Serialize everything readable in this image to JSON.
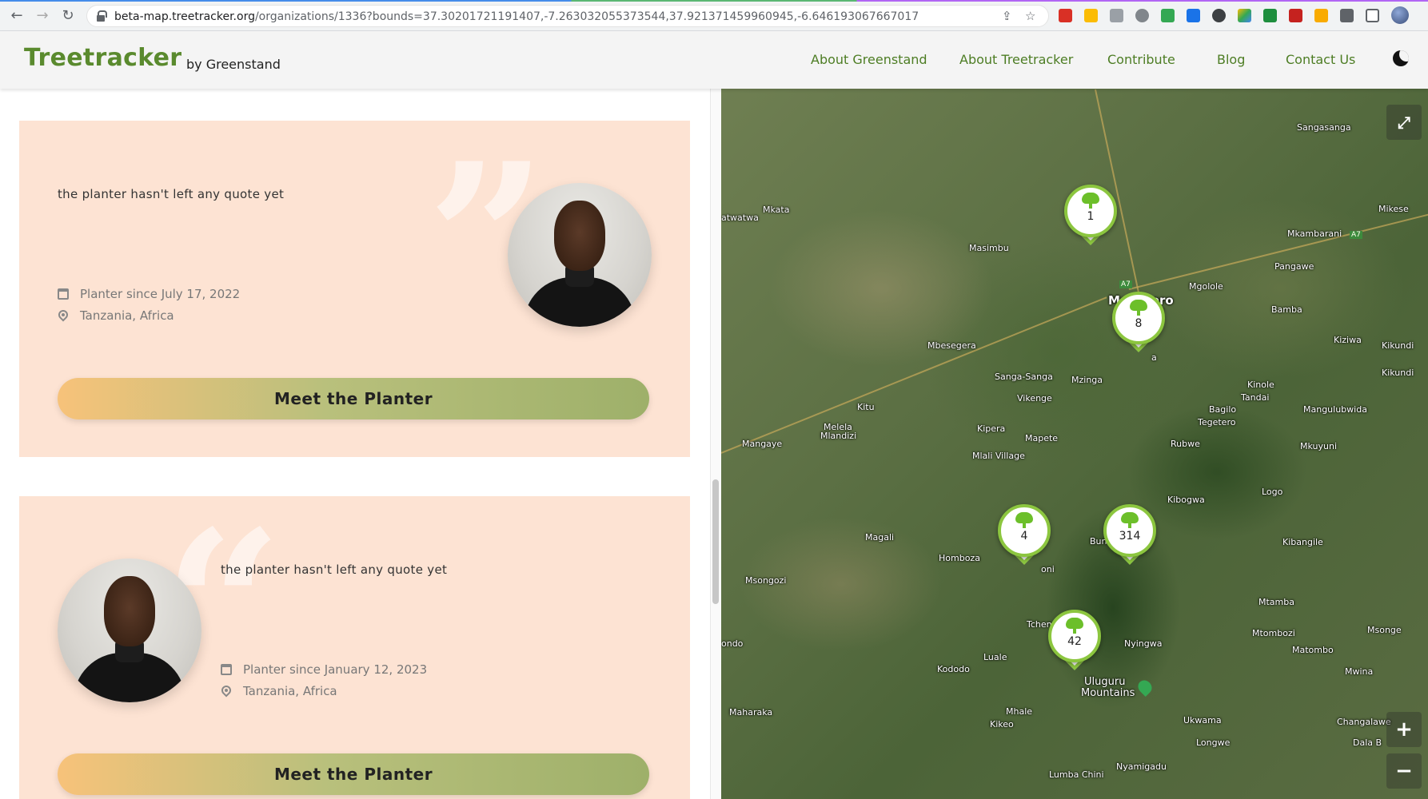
{
  "browser": {
    "url_host": "beta-map.treetracker.org",
    "url_path": "/organizations/1336?bounds=37.30201721191407,-7.263032055373544,37.921371459960945,-6.646193067667017"
  },
  "header": {
    "logo": "Treetracker",
    "logo_sub": "by Greenstand",
    "nav": [
      "About Greenstand",
      "About Treetracker",
      "Contribute",
      "Blog",
      "Contact Us"
    ]
  },
  "cards": [
    {
      "quote": "the planter hasn't left any quote yet",
      "since": "Planter since July 17, 2022",
      "location": "Tanzania, Africa",
      "button": "Meet the Planter"
    },
    {
      "quote": "the planter hasn't left any quote yet",
      "since": "Planter since January 12, 2023",
      "location": "Tanzania, Africa",
      "button": "Meet the Planter"
    }
  ],
  "map": {
    "markers": [
      "1",
      "8",
      "4",
      "314",
      "42"
    ],
    "labels": {
      "sangasanga": "Sangasanga",
      "mikese": "Mikese",
      "mkata": "Mkata",
      "atwatwa": "atwatwa",
      "masimbu": "Masimbu",
      "mkambarani": "Mkambarani",
      "pangawe": "Pangawe",
      "mgolole": "Mgolole",
      "morogoro": "Morogoro",
      "bamba": "Bamba",
      "kiziwa": "Kiziwa",
      "kikundi1": "Kikundi",
      "kikundi2": "Kikundi",
      "mbesegera": "Mbesegera",
      "sanga_sanga": "Sanga-Sanga",
      "mzinga": "Mzinga",
      "kinole": "Kinole",
      "tandai": "Tandai",
      "vikenge": "Vikenge",
      "bagilo": "Bagilo",
      "tegetero": "Tegetero",
      "mangulubwida": "Mangulubwida",
      "kitu": "Kitu",
      "melela": "Melela",
      "mlandizi": "Mlandizi",
      "kipera": "Kipera",
      "mapete": "Mapete",
      "mangaye": "Mangaye",
      "rubwe": "Rubwe",
      "mkuyuni": "Mkuyuni",
      "mlali": "Mlali Village",
      "kibogwa": "Kibogwa",
      "logo": "Logo",
      "magali": "Magali",
      "homboza": "Homboza",
      "bun": "Bun",
      "kibangile": "Kibangile",
      "msongozi": "Msongozi",
      "mtamba": "Mtamba",
      "tchenzema": "Tchenzema",
      "mtombozi": "Mtombozi",
      "msonge": "Msonge",
      "ondo": "ondo",
      "nyingwa": "Nyingwa",
      "matombo": "Matombo",
      "luale": "Luale",
      "kododo": "Kododo",
      "mwina": "Mwina",
      "uluguru": "Uluguru",
      "mountains": "Mountains",
      "maharaka": "Maharaka",
      "mhale": "Mhale",
      "kikeo": "Kikeo",
      "ukwama": "Ukwama",
      "changalawe": "Changalawe",
      "longwe": "Longwe",
      "dalab": "Dala B",
      "nyamigadu": "Nyamigadu",
      "lumba": "Lumba Chini",
      "oni": "oni",
      "we": "we",
      "a": "a",
      "a7a": "A7",
      "a7b": "A7"
    },
    "zoom_in": "+",
    "zoom_out": "−"
  }
}
